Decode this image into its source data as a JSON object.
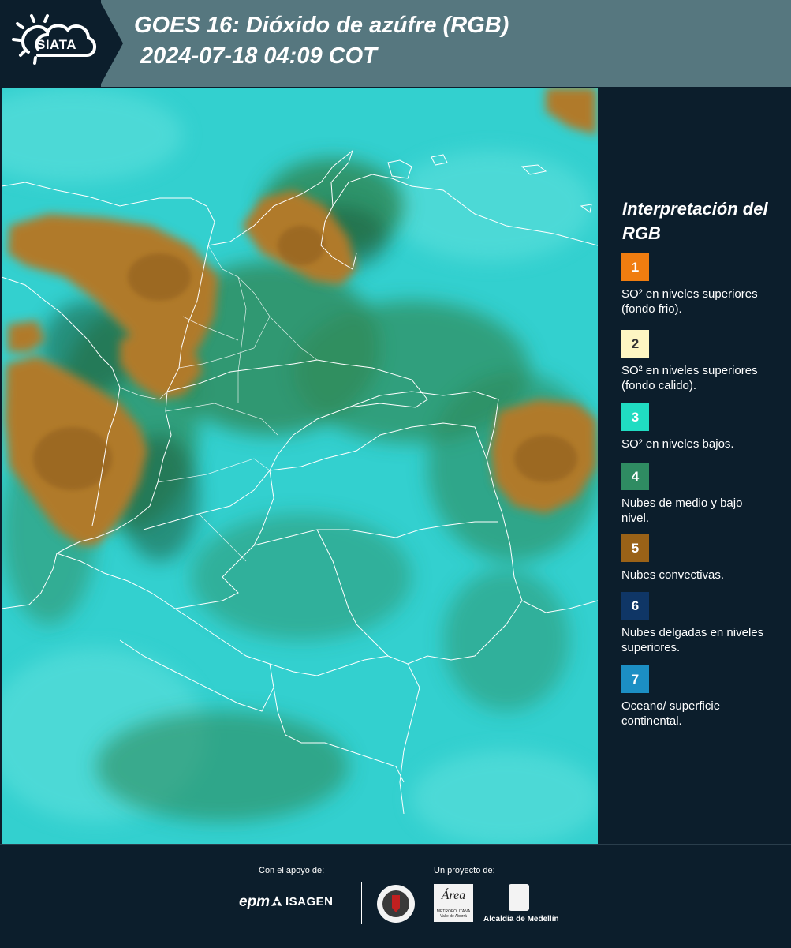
{
  "header": {
    "logo_text": "SIATA",
    "title_line1": "GOES 16: Dióxido de azúfre (RGB)",
    "title_line2": "2024-07-18 04:09 COT"
  },
  "map": {
    "background_color": "#33d0cf",
    "convective_cloud_color": "#b07a2a",
    "mid_low_cloud_color": "#2f8a5a",
    "border_color": "#ffffff"
  },
  "legend": {
    "title": "Interpretación del RGB",
    "items": [
      {
        "number": "1",
        "color": "#f07d10",
        "description": "SO² en niveles superiores (fondo frio)."
      },
      {
        "number": "2",
        "color": "#fdf6c3",
        "description": "SO² en niveles superiores (fondo calido)."
      },
      {
        "number": "3",
        "color": "#20dcc2",
        "description": "SO² en niveles bajos."
      },
      {
        "number": "4",
        "color": "#2f8c62",
        "description": "Nubes de medio y bajo nivel."
      },
      {
        "number": "5",
        "color": "#9a6217",
        "description": "Nubes convectivas."
      },
      {
        "number": "6",
        "color": "#0f3666",
        "description": "Nubes delgadas en niveles superiores."
      },
      {
        "number": "7",
        "color": "#1c8fc4",
        "description": "Oceano/ superficie continental."
      }
    ]
  },
  "footer": {
    "support_label": "Con el apoyo de:",
    "project_label": "Un proyecto de:",
    "epm": "epm",
    "isagen": "ISAGEN",
    "area_logo": "Área",
    "area_subtitle": "METROPOLITANA Valle de Aburrá",
    "alcaldia": "Alcaldía de Medellín"
  }
}
